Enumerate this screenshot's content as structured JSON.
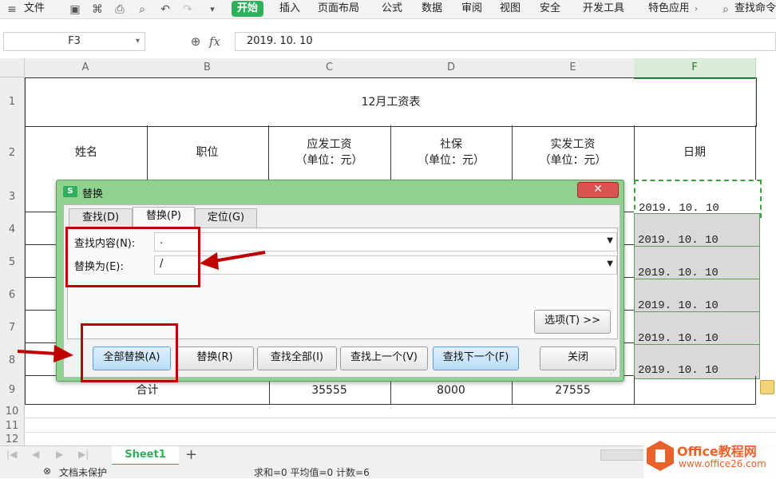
{
  "ribbon": {
    "file_label": "文件",
    "tabs": [
      "开始",
      "插入",
      "页面布局",
      "公式",
      "数据",
      "审阅",
      "视图",
      "安全",
      "开发工具",
      "特色应用"
    ],
    "search_label": "查找命令"
  },
  "formula_bar": {
    "name_box": "F3",
    "fx_label": "fx",
    "value": "2019. 10. 10"
  },
  "columns": [
    "A",
    "B",
    "C",
    "D",
    "E",
    "F"
  ],
  "rows": [
    "1",
    "2",
    "3",
    "4",
    "5",
    "6",
    "7",
    "8",
    "9",
    "10",
    "11",
    "12"
  ],
  "sheet": {
    "title": "12月工资表",
    "headers": [
      "姓名",
      "职位",
      "应发工资\n（单位：元）",
      "社保\n（单位：元）",
      "实发工资\n（单位：元）",
      "日期"
    ],
    "dates": [
      "2019. 10. 10",
      "2019. 10. 10",
      "2019. 10. 10",
      "2019. 10. 10",
      "2019. 10. 10",
      "2019. 10. 10"
    ],
    "total_label": "合计",
    "totals": [
      "35555",
      "8000",
      "27555"
    ]
  },
  "dialog": {
    "logo": "S",
    "title": "替换",
    "close": "✕",
    "tabs": [
      "查找(D)",
      "替换(P)",
      "定位(G)"
    ],
    "find_label": "查找内容(N):",
    "find_value": ".",
    "replace_label": "替换为(E):",
    "replace_value": "/",
    "options_button": "选项(T) >>",
    "buttons": [
      "全部替换(A)",
      "替换(R)",
      "查找全部(I)",
      "查找上一个(V)",
      "查找下一个(F)",
      "关闭"
    ]
  },
  "sheet_tabs": {
    "active": "Sheet1",
    "add": "+"
  },
  "status": {
    "protect": "文档未保护",
    "summary": "求和=0  平均值=0  计数=6"
  },
  "watermark": {
    "brand": "Office教程网",
    "url": "www.office26.com"
  },
  "colors": {
    "accent": "#2fb05b",
    "annotation": "#c00000",
    "dialog_frame": "#8fd18f"
  }
}
